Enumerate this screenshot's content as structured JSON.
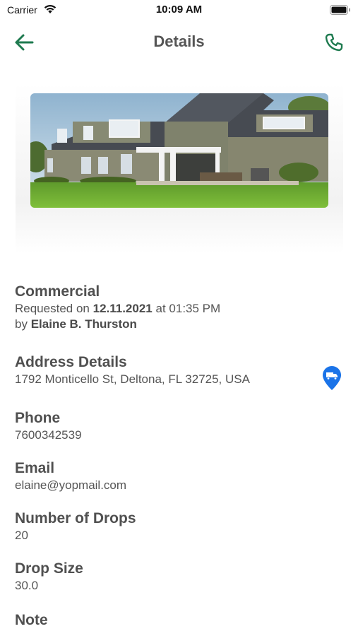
{
  "status_bar": {
    "carrier": "Carrier",
    "time": "10:09 AM"
  },
  "nav": {
    "title": "Details",
    "accent_color": "#1e7a4f"
  },
  "request": {
    "type": "Commercial",
    "requested_prefix": "Requested on",
    "date": "12.11.2021",
    "time_prefix": "at",
    "time": "01:35 PM",
    "by_prefix": "by",
    "requester": "Elaine B. Thurston"
  },
  "address": {
    "label": "Address Details",
    "value": "1792 Monticello St, Deltona, FL 32725, USA",
    "pin_color": "#1a73e8"
  },
  "phone": {
    "label": "Phone",
    "value": "7600342539"
  },
  "email": {
    "label": "Email",
    "value": "elaine@yopmail.com"
  },
  "drops": {
    "label": "Number of Drops",
    "value": "20"
  },
  "drop_size": {
    "label": "Drop Size",
    "value": "30.0"
  },
  "note": {
    "label": "Note"
  }
}
